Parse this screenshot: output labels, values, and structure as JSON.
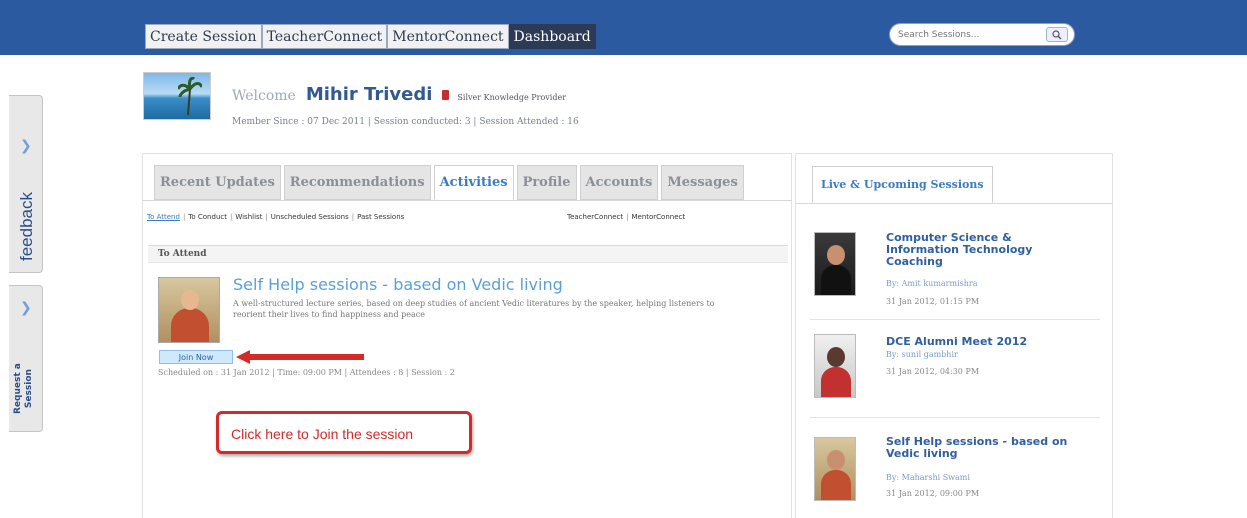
{
  "topnav": {
    "items": [
      {
        "label": "Create Session"
      },
      {
        "label": "TeacherConnect"
      },
      {
        "label": "MentorConnect"
      },
      {
        "label": "Dashboard"
      }
    ]
  },
  "search": {
    "placeholder": "Search Sessions..."
  },
  "sidebar": {
    "feedback_label": "feedback",
    "request_label_1": "Request a",
    "request_label_2": "Session"
  },
  "welcome": {
    "label": "Welcome",
    "name": "Mihir Trivedi",
    "rank": "Silver Knowledge Provider",
    "member_info": "Member Since : 07 Dec 2011  |  Session conducted: 3  |  Session Attended : 16"
  },
  "tabs": [
    {
      "label": "Recent Updates"
    },
    {
      "label": "Recommendations"
    },
    {
      "label": "Activities"
    },
    {
      "label": "Profile"
    },
    {
      "label": "Accounts"
    },
    {
      "label": "Messages"
    }
  ],
  "subnav": {
    "items": [
      "To Attend",
      "To Conduct",
      "Wishlist",
      "Unscheduled Sessions",
      "Past Sessions"
    ],
    "right_items": [
      "TeacherConnect",
      "MentorConnect"
    ]
  },
  "section": {
    "title": "To Attend"
  },
  "session": {
    "title": "Self Help sessions - based on Vedic living",
    "description": "A well-structured lecture series, based on deep studies of ancient Vedic literatures by the speaker, helping listeners to reorient their lives to find happiness and peace",
    "join_label": "Join Now",
    "schedule": "Scheduled on : 31 Jan 2012  |  Time: 09:00 PM  |  Attendees : 8  |  Session : 2"
  },
  "callout": {
    "text": "Click here to Join the session"
  },
  "right_panel": {
    "tab_label": "Live & Upcoming Sessions",
    "items": [
      {
        "title": "Computer Science & Information Technology Coaching",
        "by": "By: Amit kumarmishra",
        "date": "31 Jan 2012, 01:15 PM"
      },
      {
        "title": "DCE Alumni Meet 2012",
        "by": "By: sunil gambhir",
        "date": "31 Jan 2012, 04:30 PM"
      },
      {
        "title": "Self Help sessions - based on Vedic living",
        "by": "By: Maharshi Swami",
        "date": "31 Jan 2012, 09:00 PM"
      }
    ]
  },
  "colors": {
    "topbar": "#2c5aa0",
    "accent": "#3a7cc0",
    "callout": "#d32a2a"
  }
}
